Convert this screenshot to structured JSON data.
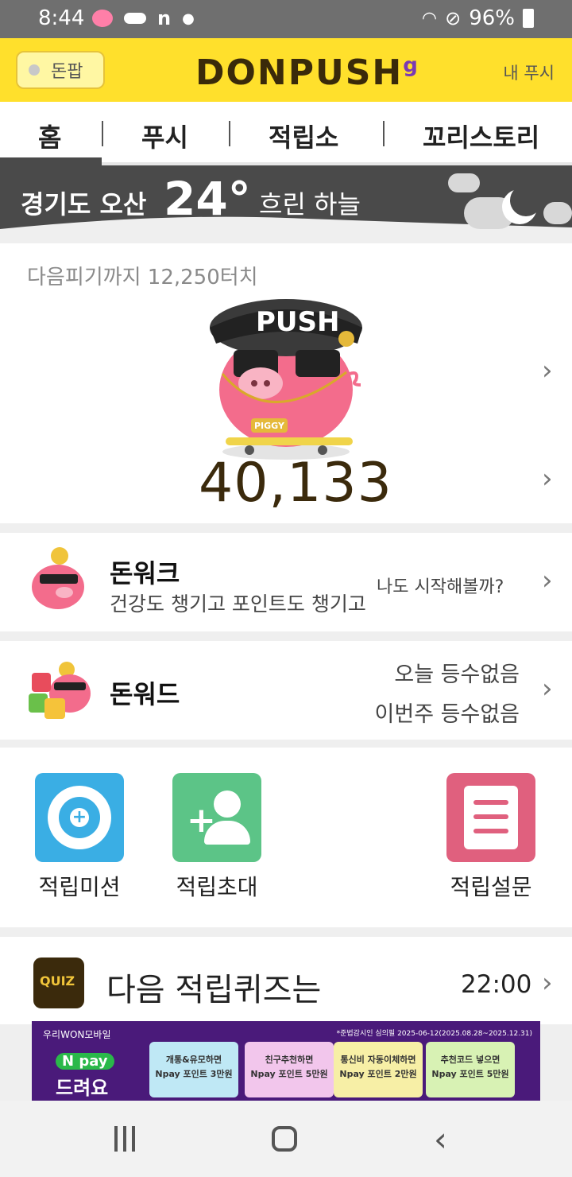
{
  "status_bar": {
    "time": "8:44",
    "battery": "96%"
  },
  "header": {
    "donpop_label": "돈팝",
    "logo": "DONPUSH",
    "logo_suffix": "g",
    "my_push": "내 푸시"
  },
  "tabs": [
    {
      "label": "홈",
      "active": true
    },
    {
      "label": "푸시"
    },
    {
      "label": "적립소"
    },
    {
      "label": "꼬리스토리"
    }
  ],
  "weather": {
    "location": "경기도 오산",
    "temperature": "24°",
    "description": "흐린 하늘"
  },
  "piggy": {
    "next_level_text": "다음피기까지 12,250터치",
    "points": "40,133",
    "badge": "PIGGY",
    "cap_text": "PUSH"
  },
  "donwalk": {
    "title": "돈워크",
    "subtitle": "건강도 챙기고 포인트도 챙기고",
    "right_text": "나도 시작해볼까?"
  },
  "donword": {
    "title": "돈워드",
    "today": "오늘 등수없음",
    "week": "이번주 등수없음"
  },
  "grid_items": [
    {
      "label": "적립미션",
      "color": "#3aaee4"
    },
    {
      "label": "적립초대",
      "color": "#5cc487"
    },
    {
      "label": "적립설문",
      "color": "#e0607e"
    }
  ],
  "quiz": {
    "title": "다음 적립퀴즈는",
    "time": "22:00",
    "badge": "QUIZ"
  },
  "ad": {
    "brand": "우리WON모바일",
    "npay": "N pay",
    "headline": "드려요",
    "notice": "*준법감시인 심의필 2025-06-12(2025.08.28~2025.12.31)",
    "boxes": [
      {
        "line1": "개통&유모하면",
        "line2": "Npay 포인트 3만원",
        "color": "#bfe8f5"
      },
      {
        "line1": "친구추천하면",
        "line2": "Npay 포인트 5만원",
        "color": "#f2c6ec"
      },
      {
        "line1": "통신비 자동이체하면",
        "line2": "Npay 포인트 2만원",
        "color": "#f7efa6"
      },
      {
        "line1": "추천코드 넣으면",
        "line2": "Npay 포인트 5만원",
        "color": "#d8f2b4"
      }
    ]
  }
}
